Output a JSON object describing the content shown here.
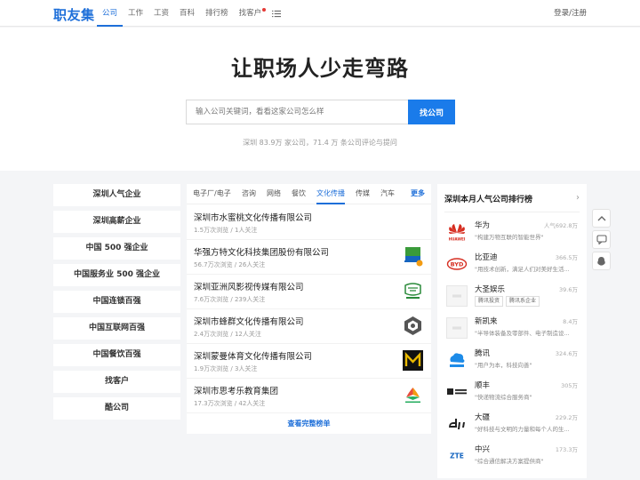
{
  "header": {
    "logo": "职友集",
    "nav": [
      "公司",
      "工作",
      "工资",
      "百科",
      "排行榜",
      "找客户"
    ],
    "login": "登录/注册"
  },
  "hero": {
    "title": "让职场人少走弯路",
    "search_placeholder": "输入公司关键词，看看这家公司怎么样",
    "search_button": "找公司",
    "stats": "深圳 83.9万 家公司，71.4 万 条公司评论与提问"
  },
  "sidebar": {
    "items": [
      "深圳人气企业",
      "深圳高薪企业",
      "中国 500 强企业",
      "中国服务业 500 强企业",
      "中国连锁百强",
      "中国互联网百强",
      "中国餐饮百强",
      "找客户",
      "酷公司"
    ]
  },
  "industry": {
    "tabs": [
      "电子厂/电子",
      "咨询",
      "网络",
      "餐饮",
      "文化传播",
      "传媒",
      "汽车"
    ],
    "active_tab": "文化传播",
    "more": "更多",
    "companies": [
      {
        "name": "深圳市水蜜桃文化传播有限公司",
        "meta": "1.5万次浏览 / 1人关注",
        "logo": "none"
      },
      {
        "name": "华强方特文化科技集团股份有限公司",
        "meta": "56.7万次浏览 / 26人关注",
        "logo": "fantawild-logo"
      },
      {
        "name": "深圳亚洲风影视传媒有限公司",
        "meta": "7.6万次浏览 / 239人关注",
        "logo": "yazhoufeng-logo"
      },
      {
        "name": "深圳市蜂群文化传播有限公司",
        "meta": "2.4万次浏览 / 12人关注",
        "logo": "fengqun-logo"
      },
      {
        "name": "深圳蒙曼体育文化传播有限公司",
        "meta": "1.9万次浏览 / 3人关注",
        "logo": "mengman-logo"
      },
      {
        "name": "深圳市思考乐教育集团",
        "meta": "17.3万次浏览 / 42人关注",
        "logo": "sikaole-logo"
      }
    ],
    "view_all": "查看完整榜单"
  },
  "ranking": {
    "title": "深圳本月人气公司排行榜",
    "items": [
      {
        "name": "华为",
        "count": "人气692.8万",
        "desc": "\"构建万物互联的智能世界\"",
        "logo": "huawei-logo"
      },
      {
        "name": "比亚迪",
        "count": "366.5万",
        "desc": "\"用技术创新，满足人们对美好生活...",
        "logo": "byd-logo"
      },
      {
        "name": "大圣娱乐",
        "count": "39.6万",
        "tags": [
          "腾讯投资",
          "腾讯系企业"
        ],
        "logo": "placeholder-logo"
      },
      {
        "name": "新凯来",
        "count": "8.4万",
        "desc": "\"半导体装备及零部件、电子制造设...",
        "logo": "placeholder-logo"
      },
      {
        "name": "腾讯",
        "count": "324.6万",
        "desc": "\"用户为本，科技向善\"",
        "logo": "tencent-logo"
      },
      {
        "name": "顺丰",
        "count": "305万",
        "desc": "\"快递物流综合服务商\"",
        "logo": "sf-logo"
      },
      {
        "name": "大疆",
        "count": "229.2万",
        "desc": "\"好科技与文明的力量和每个人的生...",
        "logo": "dji-logo"
      },
      {
        "name": "中兴",
        "count": "173.3万",
        "desc": "\"综合通信解决方案提供商\"",
        "logo": "zte-logo"
      }
    ]
  },
  "colors": {
    "accent": "#1e6fd9",
    "search_button": "#1a7bea",
    "notification_dot": "#e53935"
  }
}
